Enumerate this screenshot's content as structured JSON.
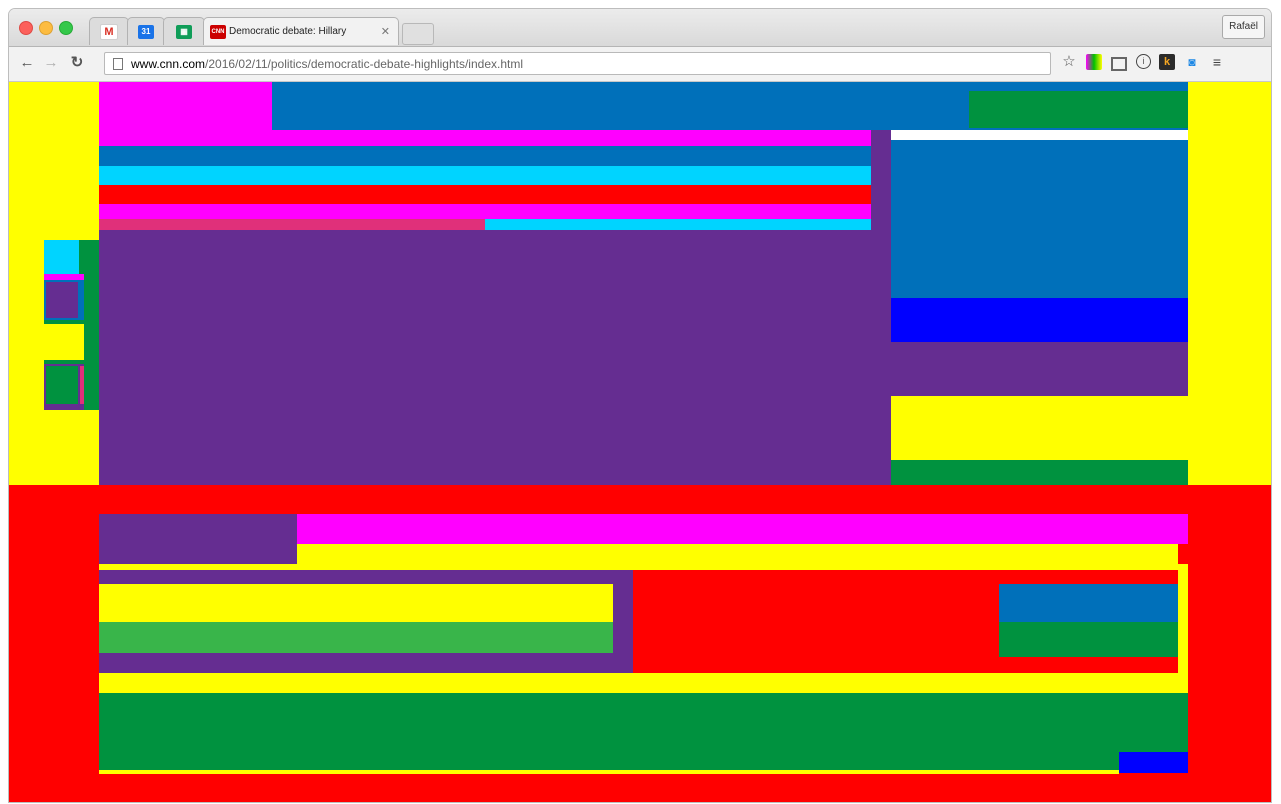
{
  "browser": {
    "profile_name": "Rafaël",
    "tabs": [
      {
        "label": "",
        "icon": "gmail-icon"
      },
      {
        "label": "",
        "icon": "calendar-icon",
        "icon_text": "31"
      },
      {
        "label": "",
        "icon": "sheets-icon"
      },
      {
        "label": "Democratic debate: Hillary",
        "icon": "cnn-icon",
        "icon_text": "CNN"
      }
    ],
    "url": {
      "host": "www.cnn.com",
      "path": "/2016/02/11/politics/democratic-debate-highlights/index.html"
    }
  },
  "colors": {
    "yellow": "#ffff00",
    "magenta": "#ff00ff",
    "blue": "#0070ba",
    "green": "#00923f",
    "cyan": "#00d4ff",
    "red": "#ff0000",
    "purple": "#652d91",
    "pink": "#e0307a",
    "bright_blue": "#0000ff",
    "light_green": "#39b54a",
    "white": "#ffffff"
  }
}
